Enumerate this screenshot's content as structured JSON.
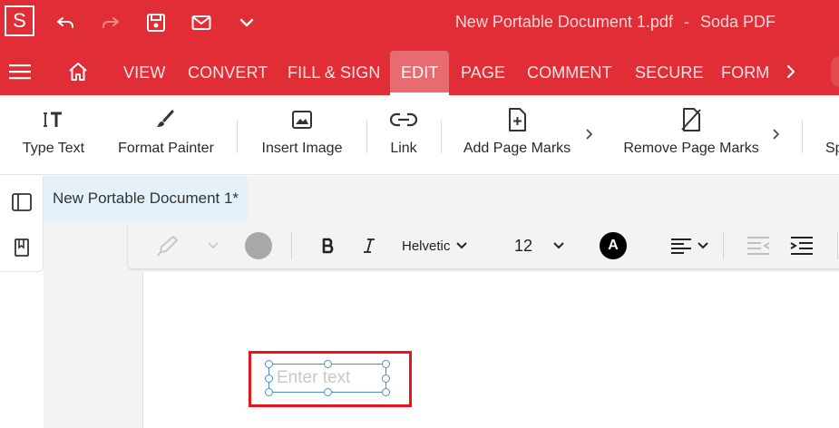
{
  "app": {
    "logo_letter": "S",
    "window_title": "New Portable Document 1.pdf",
    "title_separator": "-",
    "app_name": "Soda PDF"
  },
  "quick_access": [
    {
      "name": "undo-icon"
    },
    {
      "name": "redo-icon"
    },
    {
      "name": "save-icon"
    },
    {
      "name": "mail-icon"
    },
    {
      "name": "chevron-down-icon"
    }
  ],
  "menu": {
    "tabs": [
      {
        "label": "VIEW",
        "active": false
      },
      {
        "label": "CONVERT",
        "active": false
      },
      {
        "label": "FILL & SIGN",
        "active": false
      },
      {
        "label": "EDIT",
        "active": true
      },
      {
        "label": "PAGE",
        "active": false
      },
      {
        "label": "COMMENT",
        "active": false
      },
      {
        "label": "SECURE",
        "active": false
      },
      {
        "label": "FORM",
        "active": false
      }
    ]
  },
  "ribbon": {
    "type_text": "Type Text",
    "format_painter": "Format Painter",
    "insert_image": "Insert Image",
    "link": "Link",
    "add_page_marks": "Add Page Marks",
    "remove_page_marks": "Remove Page Marks",
    "cut_label": "Sp"
  },
  "document": {
    "tab_title": "New Portable Document 1*"
  },
  "format_bar": {
    "font_name": "Helvetic",
    "font_size": "12",
    "font_color_letter": "A"
  },
  "textbox": {
    "placeholder": "Enter text",
    "value": ""
  },
  "colors": {
    "brand_red": "#e02d36",
    "active_tab": "#e86b71",
    "selection_highlight": "#e8141b",
    "handle_blue": "#4a90c8"
  }
}
